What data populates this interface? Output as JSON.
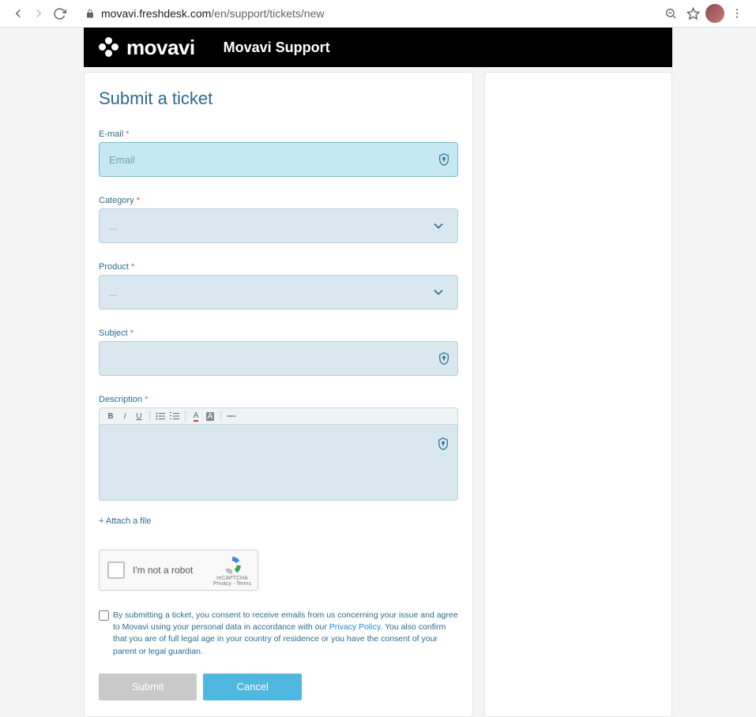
{
  "browser": {
    "url_domain": "movavi.freshdesk.com",
    "url_path": "/en/support/tickets/new"
  },
  "header": {
    "logo_text": "movavi",
    "title": "Movavi Support"
  },
  "page": {
    "title": "Submit a ticket"
  },
  "form": {
    "email": {
      "label": "E-mail",
      "placeholder": "Email",
      "value": ""
    },
    "category": {
      "label": "Category",
      "selected": "..."
    },
    "product": {
      "label": "Product",
      "selected": "..."
    },
    "subject": {
      "label": "Subject",
      "value": ""
    },
    "description": {
      "label": "Description"
    },
    "attach": "+ Attach a file"
  },
  "recaptcha": {
    "label": "I'm not a robot",
    "brand": "reCAPTCHA",
    "terms": "Privacy - Terms"
  },
  "consent": {
    "text_before": "By submitting a ticket, you consent to receive emails from us concerning your issue and agree to Movavi using your personal data in accordance with our ",
    "link_text": "Privacy Policy",
    "text_after": ". You also confirm that you are of full legal age in your country of residence or you have the consent of your parent or legal guardian."
  },
  "buttons": {
    "submit": "Submit",
    "cancel": "Cancel"
  }
}
